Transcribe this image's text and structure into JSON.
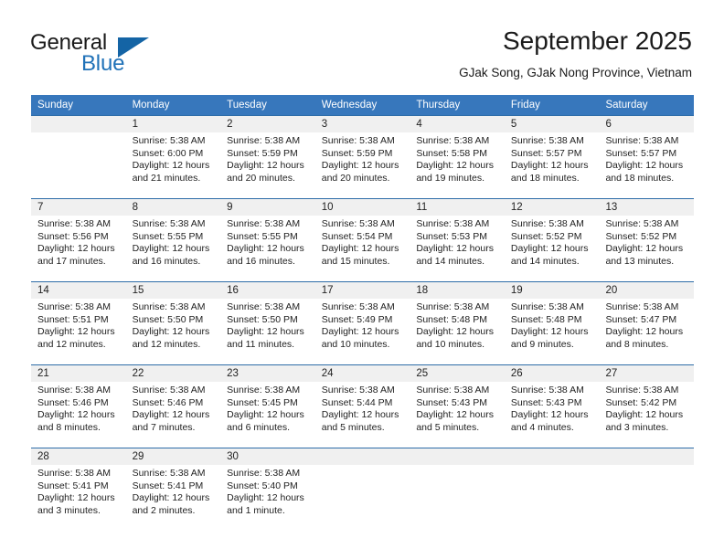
{
  "brand": {
    "name_part1": "General",
    "name_part2": "Blue",
    "triangle_color": "#1464a5",
    "blue_text_color": "#2072b8"
  },
  "header": {
    "month_title": "September 2025",
    "location": "GJak Song, GJak Nong Province, Vietnam"
  },
  "theme": {
    "header_blue": "#3777bc",
    "row_rule_blue": "#2e6da8",
    "date_band_gray": "#f0f0f0"
  },
  "calendar": {
    "weekday_headers": [
      "Sunday",
      "Monday",
      "Tuesday",
      "Wednesday",
      "Thursday",
      "Friday",
      "Saturday"
    ],
    "weeks": [
      {
        "days": [
          {
            "date": "",
            "sunrise": "",
            "sunset": "",
            "daylight_line1": "",
            "daylight_line2": ""
          },
          {
            "date": "1",
            "sunrise": "Sunrise: 5:38 AM",
            "sunset": "Sunset: 6:00 PM",
            "daylight_line1": "Daylight: 12 hours",
            "daylight_line2": "and 21 minutes."
          },
          {
            "date": "2",
            "sunrise": "Sunrise: 5:38 AM",
            "sunset": "Sunset: 5:59 PM",
            "daylight_line1": "Daylight: 12 hours",
            "daylight_line2": "and 20 minutes."
          },
          {
            "date": "3",
            "sunrise": "Sunrise: 5:38 AM",
            "sunset": "Sunset: 5:59 PM",
            "daylight_line1": "Daylight: 12 hours",
            "daylight_line2": "and 20 minutes."
          },
          {
            "date": "4",
            "sunrise": "Sunrise: 5:38 AM",
            "sunset": "Sunset: 5:58 PM",
            "daylight_line1": "Daylight: 12 hours",
            "daylight_line2": "and 19 minutes."
          },
          {
            "date": "5",
            "sunrise": "Sunrise: 5:38 AM",
            "sunset": "Sunset: 5:57 PM",
            "daylight_line1": "Daylight: 12 hours",
            "daylight_line2": "and 18 minutes."
          },
          {
            "date": "6",
            "sunrise": "Sunrise: 5:38 AM",
            "sunset": "Sunset: 5:57 PM",
            "daylight_line1": "Daylight: 12 hours",
            "daylight_line2": "and 18 minutes."
          }
        ]
      },
      {
        "days": [
          {
            "date": "7",
            "sunrise": "Sunrise: 5:38 AM",
            "sunset": "Sunset: 5:56 PM",
            "daylight_line1": "Daylight: 12 hours",
            "daylight_line2": "and 17 minutes."
          },
          {
            "date": "8",
            "sunrise": "Sunrise: 5:38 AM",
            "sunset": "Sunset: 5:55 PM",
            "daylight_line1": "Daylight: 12 hours",
            "daylight_line2": "and 16 minutes."
          },
          {
            "date": "9",
            "sunrise": "Sunrise: 5:38 AM",
            "sunset": "Sunset: 5:55 PM",
            "daylight_line1": "Daylight: 12 hours",
            "daylight_line2": "and 16 minutes."
          },
          {
            "date": "10",
            "sunrise": "Sunrise: 5:38 AM",
            "sunset": "Sunset: 5:54 PM",
            "daylight_line1": "Daylight: 12 hours",
            "daylight_line2": "and 15 minutes."
          },
          {
            "date": "11",
            "sunrise": "Sunrise: 5:38 AM",
            "sunset": "Sunset: 5:53 PM",
            "daylight_line1": "Daylight: 12 hours",
            "daylight_line2": "and 14 minutes."
          },
          {
            "date": "12",
            "sunrise": "Sunrise: 5:38 AM",
            "sunset": "Sunset: 5:52 PM",
            "daylight_line1": "Daylight: 12 hours",
            "daylight_line2": "and 14 minutes."
          },
          {
            "date": "13",
            "sunrise": "Sunrise: 5:38 AM",
            "sunset": "Sunset: 5:52 PM",
            "daylight_line1": "Daylight: 12 hours",
            "daylight_line2": "and 13 minutes."
          }
        ]
      },
      {
        "days": [
          {
            "date": "14",
            "sunrise": "Sunrise: 5:38 AM",
            "sunset": "Sunset: 5:51 PM",
            "daylight_line1": "Daylight: 12 hours",
            "daylight_line2": "and 12 minutes."
          },
          {
            "date": "15",
            "sunrise": "Sunrise: 5:38 AM",
            "sunset": "Sunset: 5:50 PM",
            "daylight_line1": "Daylight: 12 hours",
            "daylight_line2": "and 12 minutes."
          },
          {
            "date": "16",
            "sunrise": "Sunrise: 5:38 AM",
            "sunset": "Sunset: 5:50 PM",
            "daylight_line1": "Daylight: 12 hours",
            "daylight_line2": "and 11 minutes."
          },
          {
            "date": "17",
            "sunrise": "Sunrise: 5:38 AM",
            "sunset": "Sunset: 5:49 PM",
            "daylight_line1": "Daylight: 12 hours",
            "daylight_line2": "and 10 minutes."
          },
          {
            "date": "18",
            "sunrise": "Sunrise: 5:38 AM",
            "sunset": "Sunset: 5:48 PM",
            "daylight_line1": "Daylight: 12 hours",
            "daylight_line2": "and 10 minutes."
          },
          {
            "date": "19",
            "sunrise": "Sunrise: 5:38 AM",
            "sunset": "Sunset: 5:48 PM",
            "daylight_line1": "Daylight: 12 hours",
            "daylight_line2": "and 9 minutes."
          },
          {
            "date": "20",
            "sunrise": "Sunrise: 5:38 AM",
            "sunset": "Sunset: 5:47 PM",
            "daylight_line1": "Daylight: 12 hours",
            "daylight_line2": "and 8 minutes."
          }
        ]
      },
      {
        "days": [
          {
            "date": "21",
            "sunrise": "Sunrise: 5:38 AM",
            "sunset": "Sunset: 5:46 PM",
            "daylight_line1": "Daylight: 12 hours",
            "daylight_line2": "and 8 minutes."
          },
          {
            "date": "22",
            "sunrise": "Sunrise: 5:38 AM",
            "sunset": "Sunset: 5:46 PM",
            "daylight_line1": "Daylight: 12 hours",
            "daylight_line2": "and 7 minutes."
          },
          {
            "date": "23",
            "sunrise": "Sunrise: 5:38 AM",
            "sunset": "Sunset: 5:45 PM",
            "daylight_line1": "Daylight: 12 hours",
            "daylight_line2": "and 6 minutes."
          },
          {
            "date": "24",
            "sunrise": "Sunrise: 5:38 AM",
            "sunset": "Sunset: 5:44 PM",
            "daylight_line1": "Daylight: 12 hours",
            "daylight_line2": "and 5 minutes."
          },
          {
            "date": "25",
            "sunrise": "Sunrise: 5:38 AM",
            "sunset": "Sunset: 5:43 PM",
            "daylight_line1": "Daylight: 12 hours",
            "daylight_line2": "and 5 minutes."
          },
          {
            "date": "26",
            "sunrise": "Sunrise: 5:38 AM",
            "sunset": "Sunset: 5:43 PM",
            "daylight_line1": "Daylight: 12 hours",
            "daylight_line2": "and 4 minutes."
          },
          {
            "date": "27",
            "sunrise": "Sunrise: 5:38 AM",
            "sunset": "Sunset: 5:42 PM",
            "daylight_line1": "Daylight: 12 hours",
            "daylight_line2": "and 3 minutes."
          }
        ]
      },
      {
        "days": [
          {
            "date": "28",
            "sunrise": "Sunrise: 5:38 AM",
            "sunset": "Sunset: 5:41 PM",
            "daylight_line1": "Daylight: 12 hours",
            "daylight_line2": "and 3 minutes."
          },
          {
            "date": "29",
            "sunrise": "Sunrise: 5:38 AM",
            "sunset": "Sunset: 5:41 PM",
            "daylight_line1": "Daylight: 12 hours",
            "daylight_line2": "and 2 minutes."
          },
          {
            "date": "30",
            "sunrise": "Sunrise: 5:38 AM",
            "sunset": "Sunset: 5:40 PM",
            "daylight_line1": "Daylight: 12 hours",
            "daylight_line2": "and 1 minute."
          },
          {
            "date": "",
            "sunrise": "",
            "sunset": "",
            "daylight_line1": "",
            "daylight_line2": ""
          },
          {
            "date": "",
            "sunrise": "",
            "sunset": "",
            "daylight_line1": "",
            "daylight_line2": ""
          },
          {
            "date": "",
            "sunrise": "",
            "sunset": "",
            "daylight_line1": "",
            "daylight_line2": ""
          },
          {
            "date": "",
            "sunrise": "",
            "sunset": "",
            "daylight_line1": "",
            "daylight_line2": ""
          }
        ]
      }
    ]
  }
}
